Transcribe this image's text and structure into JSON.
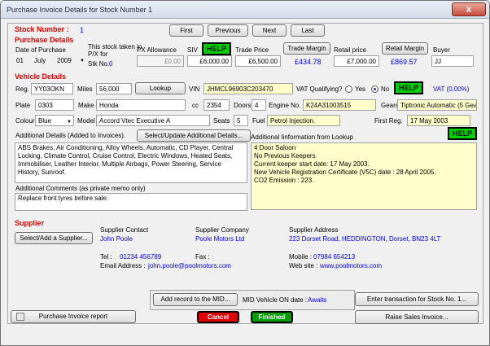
{
  "window": {
    "title": "Purchase Invoice Details for Stock Number 1",
    "close_label": "x"
  },
  "stock": {
    "label": "Stock Number :",
    "value": "1"
  },
  "nav": {
    "first": "First",
    "previous": "Previous",
    "next": "Next",
    "last": "Last"
  },
  "purchase": {
    "heading": "Purchase Details",
    "date_label": "Date of Purchase",
    "day": "01",
    "month": "July",
    "year": "2009",
    "stock_taken_label": "This stock taken in P/X for",
    "stk_no_label": "Stk No.",
    "stk_no_value": "0",
    "px_label": "PX Allowance",
    "px_value": "£0.00",
    "siv_label": "SIV",
    "help": "HELP",
    "siv_value": "£6,000.00",
    "trade_price_label": "Trade Price",
    "trade_price_value": "£6,500.00",
    "trade_margin_button": "Trade Margin",
    "trade_margin_value": "£434.78",
    "retail_price_label": "Retail price",
    "retail_price_value": "£7,000.00",
    "retail_margin_button": "Retail Margin",
    "retail_margin_value": "£869.57",
    "buyer_label": "Buyer",
    "buyer_value": "JJ"
  },
  "vehicle": {
    "heading": "Vehicle Details",
    "reg_label": "Reg.",
    "reg_value": "YY03OKN",
    "miles_label": "Miles",
    "miles_value": "56,000",
    "lookup_button": "Lookup",
    "vin_label": "VIN",
    "vin_value": "JHMCL96903C203470",
    "vat_label": "VAT Qualifying?",
    "yes_label": "Yes",
    "no_label": "No",
    "vat_selected": "No",
    "help": "HELP",
    "vat_value": "VAT (0.00%)",
    "plate_label": "Plate",
    "plate_value": "0303",
    "make_label": "Make",
    "make_value": "Honda",
    "cc_label": "cc",
    "cc_value": "2354",
    "doors_label": "Doors",
    "doors_value": "4",
    "engine_label": "Engine No.",
    "engine_value": "K24A31003515",
    "gears_label": "Gears",
    "gears_value": "Tiptronic Automatic (5 Gears)",
    "colour_label": "Colour",
    "colour_value": "Blue",
    "model_label": "Model",
    "model_value": "Accord Vtec Executive A",
    "seats_label": "Seats",
    "seats_value": "5",
    "fuel_label": "Fuel",
    "fuel_value": "Petrol Injection.",
    "first_reg_label": "First Reg.",
    "first_reg_value": "17 May 2003"
  },
  "additional": {
    "label": "Additional Details (Added to Invoices).",
    "select_button": "Select/Update Additional Details...",
    "text": "ABS Brakes, Air Conditioning, Alloy Wheels, Automatic, CD Player, Central Locking, Climate Control, Cruise Control, Electric Windows, Heated Seats, Immobiliser, Leather Interior, Multiple Airbags, Power Steering, Service History, Sunroof.",
    "comments_label": "Additional Comments (as private memo only)",
    "comments_value": "Replace front tyres before sale."
  },
  "lookup_info": {
    "label": "Additional Iinformation from Lookup",
    "help": "HELP",
    "lines": [
      "4 Door Saloon",
      "No Previous Keepers",
      "Current keeper start date: 17 May 2003.",
      "New Vehicle Registration Certificate (V5C) date : 28 April 2005.",
      "CO2 Emission : 223."
    ]
  },
  "supplier": {
    "heading": "Supplier",
    "select_button": "Select/Add a Supplier...",
    "contact_label": "Supplier Contact",
    "contact_value": "John Poole",
    "company_label": "Supplier Company",
    "company_value": "Poole Motors Ltd",
    "address_label": "Supplier Address",
    "address_value": "223 Dorset Road, HEDDINGTON, Dorset, BN23 4LT",
    "tel_label": "Tel :",
    "tel_value": "01234 456789",
    "fax_label": "Fax :",
    "fax_value": "",
    "mobile_label": "Mobile :",
    "mobile_value": "07984 654213",
    "email_label": "Email Address :",
    "email_value": "john.poole@poolmotors.com",
    "web_label": "Web site :",
    "web_value": "www.poolmotors.com"
  },
  "footer": {
    "add_mid_button": "Add record to the MID...",
    "mid_label": "MID Vehicle ON date :",
    "mid_value": "Awaits",
    "enter_transaction_button": "Enter transaction for Stock No. 1...",
    "report_button": "Purchase Invoice report",
    "cancel_button": "Cancel",
    "finished_button": "Finished",
    "raise_sales_button": "Raise Sales Invoice..."
  },
  "colors": {
    "heading": "#e00000",
    "link": "#0000ff",
    "help": "#00d000",
    "yellow": "#ffffcc",
    "cancel": "#e00000",
    "finished": "#00a000"
  }
}
